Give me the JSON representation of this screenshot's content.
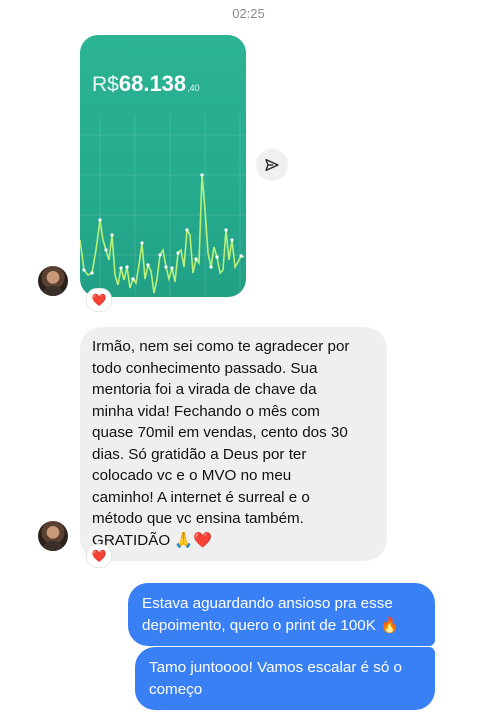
{
  "header": {
    "time": "02:25"
  },
  "image_message": {
    "amount_currency": "R$",
    "amount_main": "68.138",
    "amount_cents": ",40",
    "reaction": "❤️"
  },
  "icons": {
    "share": "paper-plane-icon",
    "heart": "heart-icon",
    "avatar": "avatar"
  },
  "messages": {
    "incoming_text": "Irmão, nem sei como te agradecer por\ntodo conhecimento passado. Sua\nmentoria foi a virada de chave da\nminha vida! Fechando o mês com\nquase 70mil em vendas, cento dos 30\ndias. Só gratidão a Deus por ter\ncolocado vc e o MVO no meu\ncaminho! A internet é surreal e o\nmétodo que vc ensina também.\nGRATIDÃO 🙏❤️",
    "incoming_reaction": "❤️",
    "outgoing_1": "Estava aguardando ansioso pra esse\ndepoimento, quero o print de 100K 🔥",
    "outgoing_2": "Tamo juntoooo! Vamos escalar é só o\ncomeço"
  },
  "colors": {
    "card_green": "#2bb394",
    "line_green": "#b8f07a",
    "outgoing_blue": "#3a80f5",
    "incoming_gray": "#efefef",
    "heart_red": "#e8213a"
  }
}
